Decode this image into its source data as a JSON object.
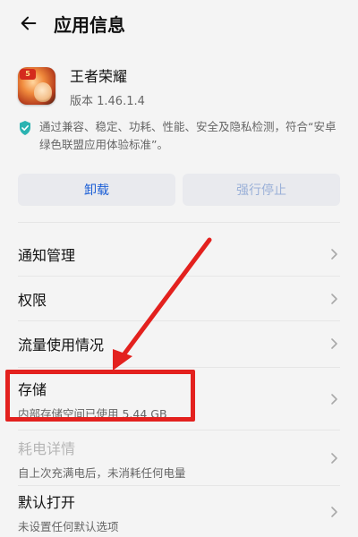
{
  "header": {
    "title": "应用信息"
  },
  "app": {
    "name": "王者荣耀",
    "version": "版本 1.46.1.4",
    "icon_badge": "5"
  },
  "certification": {
    "text": "通过兼容、稳定、功耗、性能、安全及隐私检测，符合“安卓绿色联盟应用体验标准”。"
  },
  "actions": {
    "uninstall_label": "卸载",
    "force_stop_label": "强行停止"
  },
  "settings": {
    "notifications": {
      "label": "通知管理"
    },
    "permissions": {
      "label": "权限"
    },
    "data_usage": {
      "label": "流量使用情况"
    },
    "storage": {
      "label": "存储",
      "subtitle": "内部存储空间已使用 5.44 GB"
    },
    "battery": {
      "label": "耗电详情",
      "subtitle": "自上次充满电后，未消耗任何电量"
    },
    "default_open": {
      "label": "默认打开",
      "subtitle": "未设置任何默认选项"
    }
  },
  "colors": {
    "accent_blue": "#1c5fd6",
    "disabled_blue": "#9ab0d8",
    "annotation_red": "#e3211e",
    "shield_teal": "#2bb3b1"
  },
  "icons": [
    "back-arrow-icon",
    "shield-check-icon",
    "chevron-right-icon"
  ]
}
